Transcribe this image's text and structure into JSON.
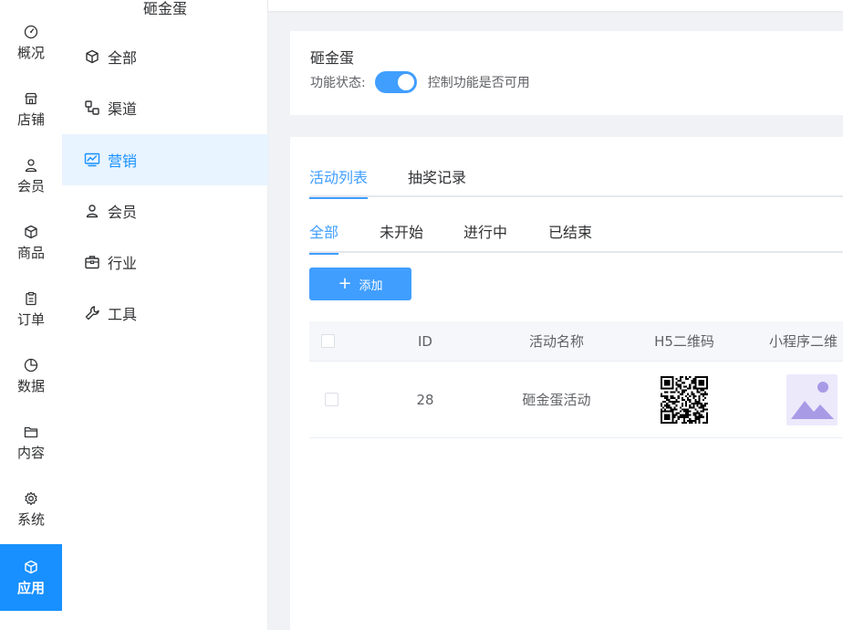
{
  "rail": {
    "items": [
      {
        "label": "概况",
        "icon": "dashboard-icon"
      },
      {
        "label": "店铺",
        "icon": "store-icon"
      },
      {
        "label": "会员",
        "icon": "user-icon"
      },
      {
        "label": "商品",
        "icon": "box-icon"
      },
      {
        "label": "订单",
        "icon": "clipboard-icon"
      },
      {
        "label": "数据",
        "icon": "pie-chart-icon"
      },
      {
        "label": "内容",
        "icon": "folder-icon"
      },
      {
        "label": "系统",
        "icon": "gear-icon"
      },
      {
        "label": "应用",
        "icon": "cube-icon",
        "active": true
      }
    ]
  },
  "submenu": {
    "title": "砸金蛋",
    "items": [
      {
        "label": "全部",
        "icon": "cube-icon"
      },
      {
        "label": "渠道",
        "icon": "channel-icon"
      },
      {
        "label": "营销",
        "icon": "marketing-monitor-icon",
        "active": true
      },
      {
        "label": "会员",
        "icon": "user-icon"
      },
      {
        "label": "行业",
        "icon": "briefcase-icon"
      },
      {
        "label": "工具",
        "icon": "wrench-icon"
      }
    ]
  },
  "status_card": {
    "title": "砸金蛋",
    "status_label": "功能状态:",
    "toggle_on": true,
    "hint": "控制功能是否可用"
  },
  "tabs_main": [
    "活动列表",
    "抽奖记录"
  ],
  "tabs_filter": [
    "全部",
    "未开始",
    "进行中",
    "已结束"
  ],
  "add_button": {
    "label": "添加"
  },
  "table": {
    "headers": [
      "ID",
      "活动名称",
      "H5二维码",
      "小程序二维"
    ],
    "rows": [
      {
        "id": "28",
        "name": "砸金蛋活动"
      }
    ]
  },
  "colors": {
    "accent": "#409eff",
    "rail_active": "#1890ff",
    "submenu_active_bg": "#e8f4ff",
    "image_placeholder": "#a99ae6"
  }
}
